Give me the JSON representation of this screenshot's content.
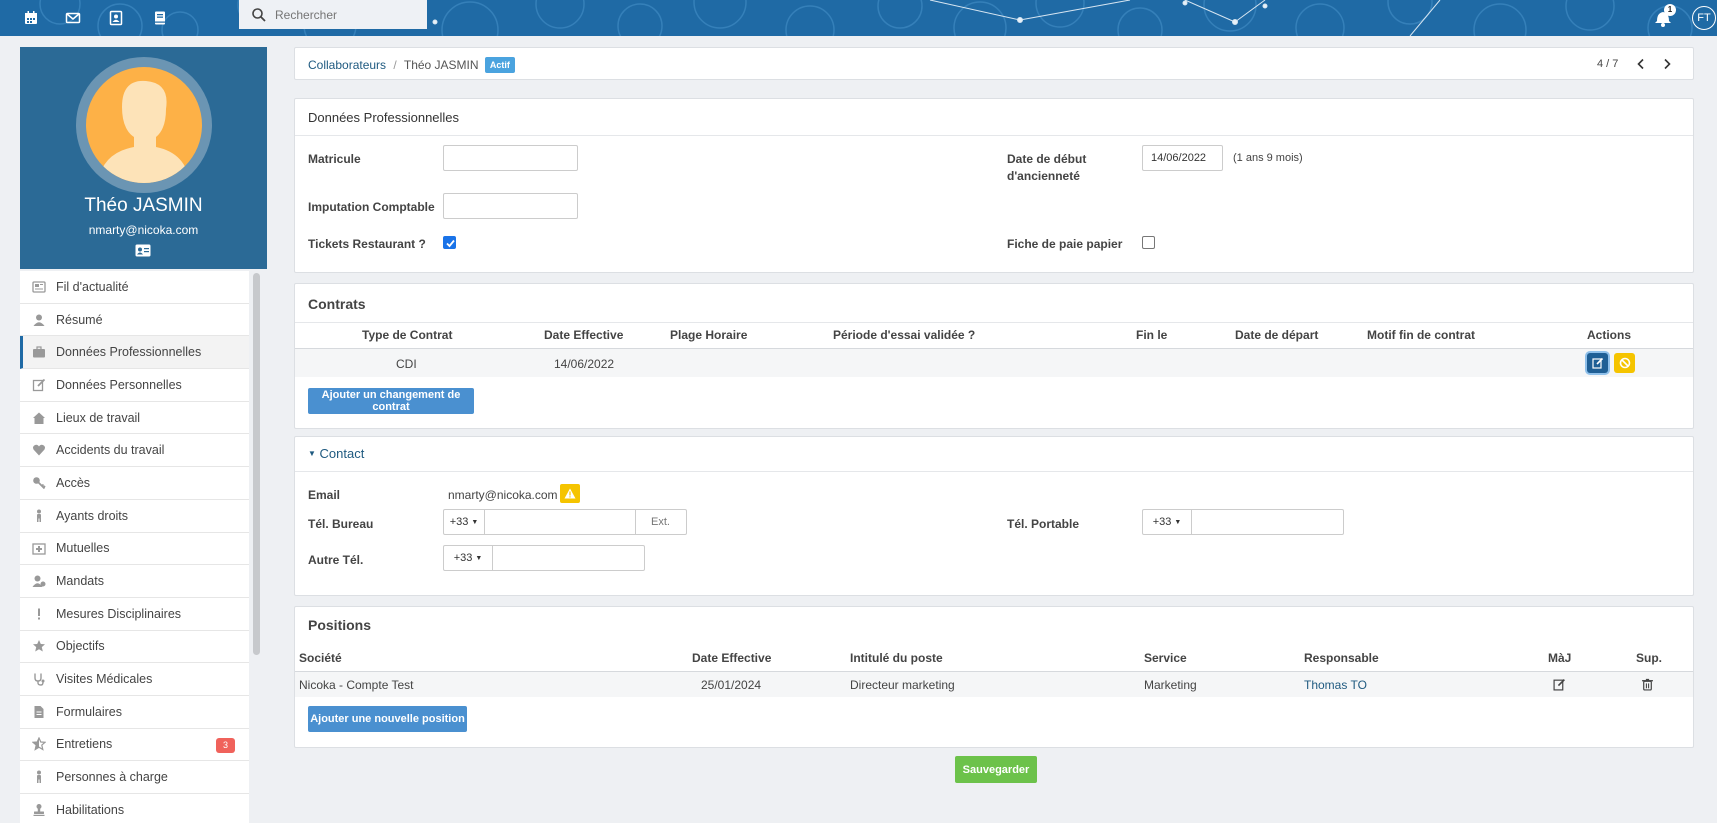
{
  "topbar": {
    "icons": [
      "calendar-icon",
      "mail-icon",
      "contacts-icon",
      "book-icon"
    ],
    "search_placeholder": "Rechercher",
    "notification_count": "1",
    "user_initials": "FT"
  },
  "profile": {
    "name": "Théo JASMIN",
    "email": "nmarty@nicoka.com"
  },
  "menu": [
    {
      "label": "Fil d'actualité",
      "icon": "newspaper-icon"
    },
    {
      "label": "Résumé",
      "icon": "user-icon"
    },
    {
      "label": "Données Professionnelles",
      "icon": "briefcase-icon",
      "active": true
    },
    {
      "label": "Données Personnelles",
      "icon": "edit-icon"
    },
    {
      "label": "Lieux de travail",
      "icon": "home-icon"
    },
    {
      "label": "Accidents du travail",
      "icon": "heartbeat-icon"
    },
    {
      "label": "Accès",
      "icon": "key-icon"
    },
    {
      "label": "Ayants droits",
      "icon": "child-icon"
    },
    {
      "label": "Mutuelles",
      "icon": "hospital-icon"
    },
    {
      "label": "Mandats",
      "icon": "user-badge-icon"
    },
    {
      "label": "Mesures Disciplinaires",
      "icon": "exclamation-icon"
    },
    {
      "label": "Objectifs",
      "icon": "star-icon"
    },
    {
      "label": "Visites Médicales",
      "icon": "stethoscope-icon"
    },
    {
      "label": "Formulaires",
      "icon": "file-icon"
    },
    {
      "label": "Entretiens",
      "icon": "star-half-icon",
      "count": "3"
    },
    {
      "label": "Personnes à charge",
      "icon": "child-icon"
    },
    {
      "label": "Habilitations",
      "icon": "stamp-icon"
    }
  ],
  "breadcrumb": {
    "parent": "Collaborateurs",
    "separator": "/",
    "current": "Théo JASMIN",
    "status": "Actif",
    "pager": "4 / 7"
  },
  "pro": {
    "title": "Données Professionnelles",
    "matricule_label": "Matricule",
    "matricule_value": "",
    "imputation_label": "Imputation Comptable",
    "imputation_value": "",
    "tickets_label": "Tickets Restaurant ?",
    "tickets_checked": true,
    "anciennete_label_1": "Date de début",
    "anciennete_label_2": "d'ancienneté",
    "anciennete_value": "14/06/2022",
    "anciennete_duration": "(1 ans  9 mois)",
    "fiche_label": "Fiche de paie papier",
    "fiche_checked": false
  },
  "contrats": {
    "title": "Contrats",
    "headers": [
      "Type de Contrat",
      "Date Effective",
      "Plage Horaire",
      "Période d'essai validée ?",
      "Fin le",
      "Date de départ",
      "Motif fin de contrat",
      "Actions"
    ],
    "rows": [
      {
        "type": "CDI",
        "date": "14/06/2022",
        "plage": "",
        "essai": "",
        "fin": "",
        "depart": "",
        "motif": ""
      }
    ],
    "add_button": "Ajouter un changement de contrat"
  },
  "contact": {
    "title": "Contact",
    "email_label": "Email",
    "email_value": "nmarty@nicoka.com",
    "bureau_label": "Tél. Bureau",
    "bureau_cc": "+33",
    "bureau_value": "",
    "ext_placeholder": "Ext.",
    "portable_label": "Tél. Portable",
    "portable_cc": "+33",
    "portable_value": "",
    "autre_label": "Autre Tél.",
    "autre_cc": "+33",
    "autre_value": ""
  },
  "positions": {
    "title": "Positions",
    "headers": [
      "Société",
      "Date Effective",
      "Intitulé du poste",
      "Service",
      "Responsable",
      "MàJ",
      "Sup."
    ],
    "rows": [
      {
        "societe": "Nicoka - Compte Test",
        "date": "25/01/2024",
        "poste": "Directeur marketing",
        "service": "Marketing",
        "responsable": "Thomas TO"
      }
    ],
    "add_button": "Ajouter une nouvelle position"
  },
  "save_button": "Sauvegarder",
  "colors": {
    "accent": "#1f6aa5",
    "profile_bg": "#2b6a96",
    "save": "#6cc24a",
    "warning": "#f5c400",
    "badge": "#f0625b"
  }
}
